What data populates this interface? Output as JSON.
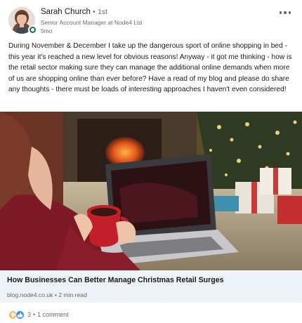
{
  "author": {
    "name": "Sarah Church",
    "separator": "•",
    "degree": "1st",
    "headline": "Senior Account Manager at Node4 Ltd",
    "time_ago": "5mo"
  },
  "post": {
    "text": "During November & December I take up the dangerous sport of online shopping in bed - this year it's reached a new level for obvious reasons! Anyway - it got me thinking - how is the retail sector making sure they can manage the additional online demands when more of us are shopping online than ever before? Have a read of my blog and please do share any thoughts - there must be loads of interesting approaches I haven't even considered!"
  },
  "article": {
    "title": "How Businesses Can Better Manage Christmas Retail Surges",
    "domain": "blog.node4.co.uk",
    "separator": "•",
    "read_time": "2 min read"
  },
  "social": {
    "reaction_count": "3",
    "separator": "•",
    "comments": "1 comment"
  },
  "icons": {
    "reactions": [
      "insightful-icon",
      "like-icon"
    ],
    "menu": "more-options-icon"
  },
  "colors": {
    "presence": "#057642",
    "like": "#378fe9",
    "insightful": "#f5bb5c",
    "article_bg": "#eef3f8"
  }
}
